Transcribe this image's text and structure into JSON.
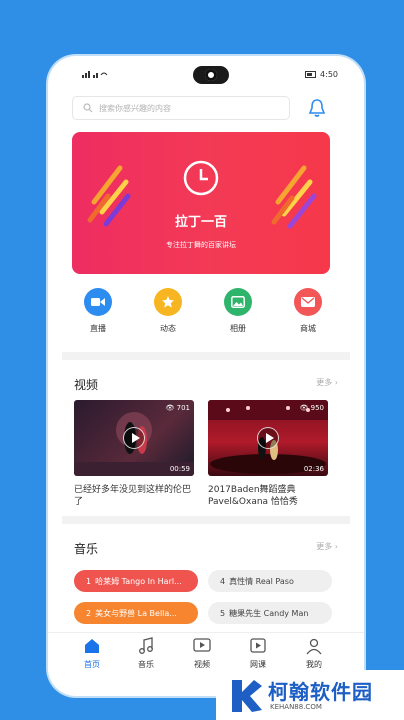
{
  "status": {
    "left": "    ",
    "time": "4:50"
  },
  "search": {
    "placeholder": "搜索你感兴趣的内容"
  },
  "banner": {
    "title": "拉丁一百",
    "subtitle": "专注拉丁舞的百家讲坛"
  },
  "nav": [
    {
      "label": "直播",
      "color": "#2d8cf0",
      "icon": "video-camera-icon"
    },
    {
      "label": "动态",
      "color": "#f7b521",
      "icon": "star-icon"
    },
    {
      "label": "相册",
      "color": "#2fb56b",
      "icon": "image-icon"
    },
    {
      "label": "商城",
      "color": "#f25656",
      "icon": "mail-icon"
    }
  ],
  "videos_section": {
    "title": "视频",
    "more": "更多 ›"
  },
  "videos": [
    {
      "views": "701",
      "duration": "00:59",
      "caption": "已经好多年没见到这样的伦巴了"
    },
    {
      "views": "950",
      "duration": "02:36",
      "caption": "2017Baden舞蹈盛典Pavel&Oxana 恰恰秀"
    }
  ],
  "music_section": {
    "title": "音乐",
    "more": "更多 ›"
  },
  "music": [
    {
      "num": "1",
      "title": "哈莱姆 Tango In Harl...",
      "bg": "#f0544f",
      "fg": "#ffffff"
    },
    {
      "num": "4",
      "title": "真性情 Real Paso",
      "bg": "#efefef",
      "fg": "#444444"
    },
    {
      "num": "2",
      "title": "美女与野兽 La Bella...",
      "bg": "#f7842f",
      "fg": "#ffffff"
    },
    {
      "num": "5",
      "title": "糖果先生 Candy Man",
      "bg": "#efefef",
      "fg": "#444444"
    }
  ],
  "tabs": [
    {
      "label": "首页",
      "active": true
    },
    {
      "label": "音乐",
      "active": false
    },
    {
      "label": "视频",
      "active": false
    },
    {
      "label": "网课",
      "active": false
    },
    {
      "label": "我的",
      "active": false
    }
  ],
  "watermark": {
    "name": "柯翰软件园",
    "url": "KEHAN88.COM"
  }
}
